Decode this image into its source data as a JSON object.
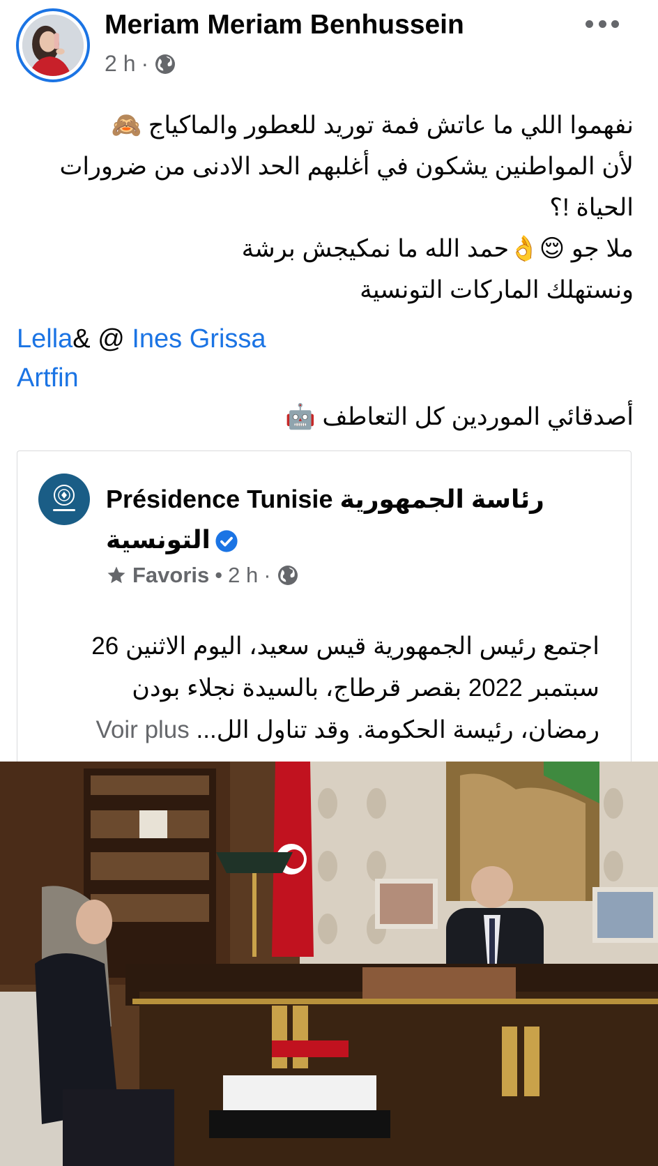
{
  "post": {
    "author_name": "Meriam Meriam Benhussein",
    "time": "2 h",
    "separator": "·",
    "privacy_icon": "globe-icon",
    "lines": [
      "نفهموا اللي ما عاتش فمة توريد  للعطور والماكياج 🙈",
      "لأن المواطنين يشكون في أغلبهم الحد الادنى من ضرورات",
      "الحياة !؟",
      "ملا جو 😌👌حمد الله ما نمكيجش برشة",
      "ونستهلك الماركات التونسية"
    ],
    "mention_1": "Lella",
    "mention_sep": "& @",
    "mention_2": "Ines Grissa",
    "mention_3": "Artfin",
    "friends_line": "أصدقائي الموردين  كل التعاطف 🤖"
  },
  "shared": {
    "name_line_1": "Présidence Tunisie رئاسة الجمهورية",
    "name_line_2": "التونسية",
    "badge_icon": "verified-icon",
    "favoris": "Favoris",
    "dot": "•",
    "time": "2 h",
    "separator": "·",
    "lines": [
      "اجتمع رئيس الجمهورية قيس سعيد، اليوم الاثنين 26",
      "سبتمبر 2022 بقصر قرطاج، بالسيدة نجلاء بودن",
      "رمضان، رئيسة الحكومة. وقد تناول الل..."
    ],
    "see_more": "Voir plus"
  },
  "colors": {
    "link": "#1b74e4",
    "meta": "#65676b",
    "text": "#050505",
    "avatar_ring": "#1b74e4",
    "shared_avatar": "#1a5d86"
  }
}
